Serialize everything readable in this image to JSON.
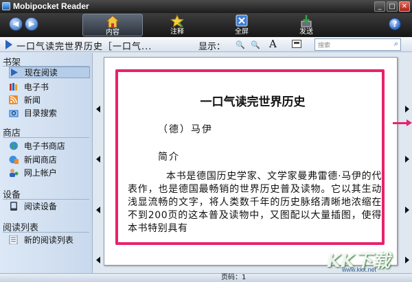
{
  "window": {
    "title": "Mobipocket Reader"
  },
  "toolbar": {
    "buttons": [
      {
        "label": "内容",
        "icon": "home-icon"
      },
      {
        "label": "注释",
        "icon": "star-icon"
      },
      {
        "label": "全屏",
        "icon": "fullscreen-icon"
      },
      {
        "label": "发送",
        "icon": "send-icon"
      }
    ],
    "help": "?"
  },
  "addressbar": {
    "book_title": "一口气读完世界历史［一口气...",
    "display_label": "显示：",
    "font_label": "A",
    "search_placeholder": "搜索"
  },
  "sidebar": {
    "sections": [
      {
        "title": "书架",
        "items": [
          {
            "label": "现在阅读",
            "icon": "play-icon",
            "selected": true
          },
          {
            "label": "电子书",
            "icon": "books-icon"
          },
          {
            "label": "新闻",
            "icon": "rss-icon"
          },
          {
            "label": "目录搜索",
            "icon": "search-folder-icon"
          }
        ]
      },
      {
        "title": "商店",
        "items": [
          {
            "label": "电子书商店",
            "icon": "globe-icon"
          },
          {
            "label": "新闻商店",
            "icon": "globe-news-icon"
          },
          {
            "label": "网上帐户",
            "icon": "user-icon"
          }
        ]
      },
      {
        "title": "设备",
        "items": [
          {
            "label": "阅读设备",
            "icon": "device-icon"
          }
        ]
      },
      {
        "title": "阅读列表",
        "items": [
          {
            "label": "新的阅读列表",
            "icon": "list-icon"
          }
        ]
      }
    ]
  },
  "page": {
    "heading": "一口气读完世界历史",
    "author": "（德）马伊",
    "intro_heading": "简介",
    "body": "本书是德国历史学家、文学家曼弗雷德·马伊的代表作，也是德国最畅销的世界历史普及读物。它以其生动浅显流畅的文字，将人类数千年的历史脉络清晰地浓缩在不到200页的这本普及读物中，又图配以大量插图，使得本书特别具有"
  },
  "status": {
    "page_label": "页码：1"
  },
  "watermark": {
    "brand": "KK下载",
    "url": "www.kkx.net"
  },
  "colors": {
    "highlight": "#e8226a",
    "accent": "#2a64c4"
  }
}
